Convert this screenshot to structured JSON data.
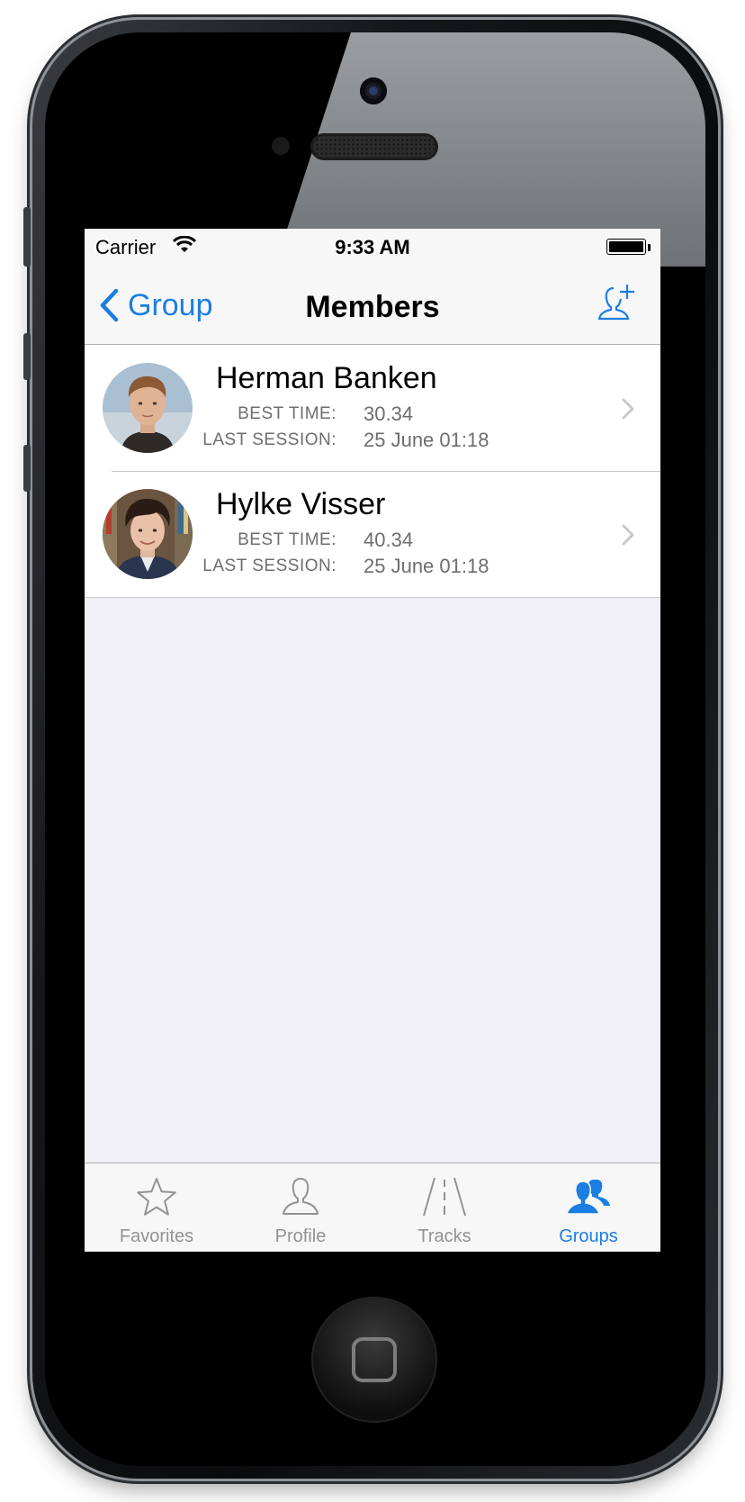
{
  "status_bar": {
    "carrier": "Carrier",
    "time": "9:33 AM"
  },
  "nav": {
    "back_label": "Group",
    "title": "Members"
  },
  "members": [
    {
      "name": "Herman Banken",
      "best_time_label": "BEST TIME:",
      "best_time": "30.34",
      "last_session_label": "LAST SESSION:",
      "last_session": "25 June 01:18"
    },
    {
      "name": "Hylke Visser",
      "best_time_label": "BEST TIME:",
      "best_time": "40.34",
      "last_session_label": "LAST SESSION:",
      "last_session": "25 June 01:18"
    }
  ],
  "tabs": [
    {
      "label": "Favorites",
      "icon": "star-icon",
      "active": false
    },
    {
      "label": "Profile",
      "icon": "person-icon",
      "active": false
    },
    {
      "label": "Tracks",
      "icon": "road-icon",
      "active": false
    },
    {
      "label": "Groups",
      "icon": "group-icon",
      "active": true
    }
  ],
  "colors": {
    "accent": "#1a7ee3",
    "inactive": "#929292",
    "background": "#efeff4"
  }
}
